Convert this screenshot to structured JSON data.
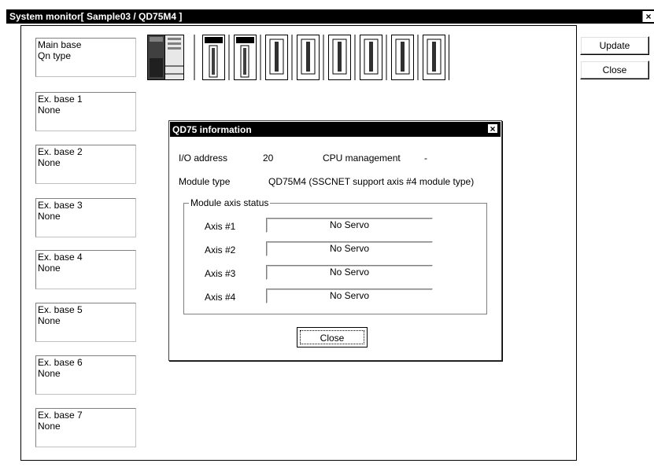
{
  "window": {
    "title": "System monitor[ Sample03 / QD75M4 ]",
    "close_glyph": "×"
  },
  "buttons": {
    "update": "Update",
    "close": "Close"
  },
  "bases": [
    {
      "name": "Main base",
      "type": "Qn type"
    },
    {
      "name": "Ex. base 1",
      "type": "None"
    },
    {
      "name": "Ex. base 2",
      "type": "None"
    },
    {
      "name": "Ex. base 3",
      "type": "None"
    },
    {
      "name": "Ex. base 4",
      "type": "None"
    },
    {
      "name": "Ex. base 5",
      "type": "None"
    },
    {
      "name": "Ex. base 6",
      "type": "None"
    },
    {
      "name": "Ex. base 7",
      "type": "None"
    }
  ],
  "dialog": {
    "title": "QD75 information",
    "close_glyph": "×",
    "io_address_label": "I/O address",
    "io_address_value": "20",
    "cpu_mgmt_label": "CPU management",
    "cpu_mgmt_value": "-",
    "module_type_label": "Module type",
    "module_type_value": "QD75M4 (SSCNET support axis #4 module type)",
    "group_label": "Module axis status",
    "axes": [
      {
        "label": "Axis #1",
        "status": "No Servo"
      },
      {
        "label": "Axis #2",
        "status": "No Servo"
      },
      {
        "label": "Axis #3",
        "status": "No Servo"
      },
      {
        "label": "Axis #4",
        "status": "No Servo"
      }
    ],
    "close_button": "Close"
  },
  "colors": {
    "titlebar": "#000000",
    "face": "#ffffff",
    "shadow": "#808080"
  }
}
